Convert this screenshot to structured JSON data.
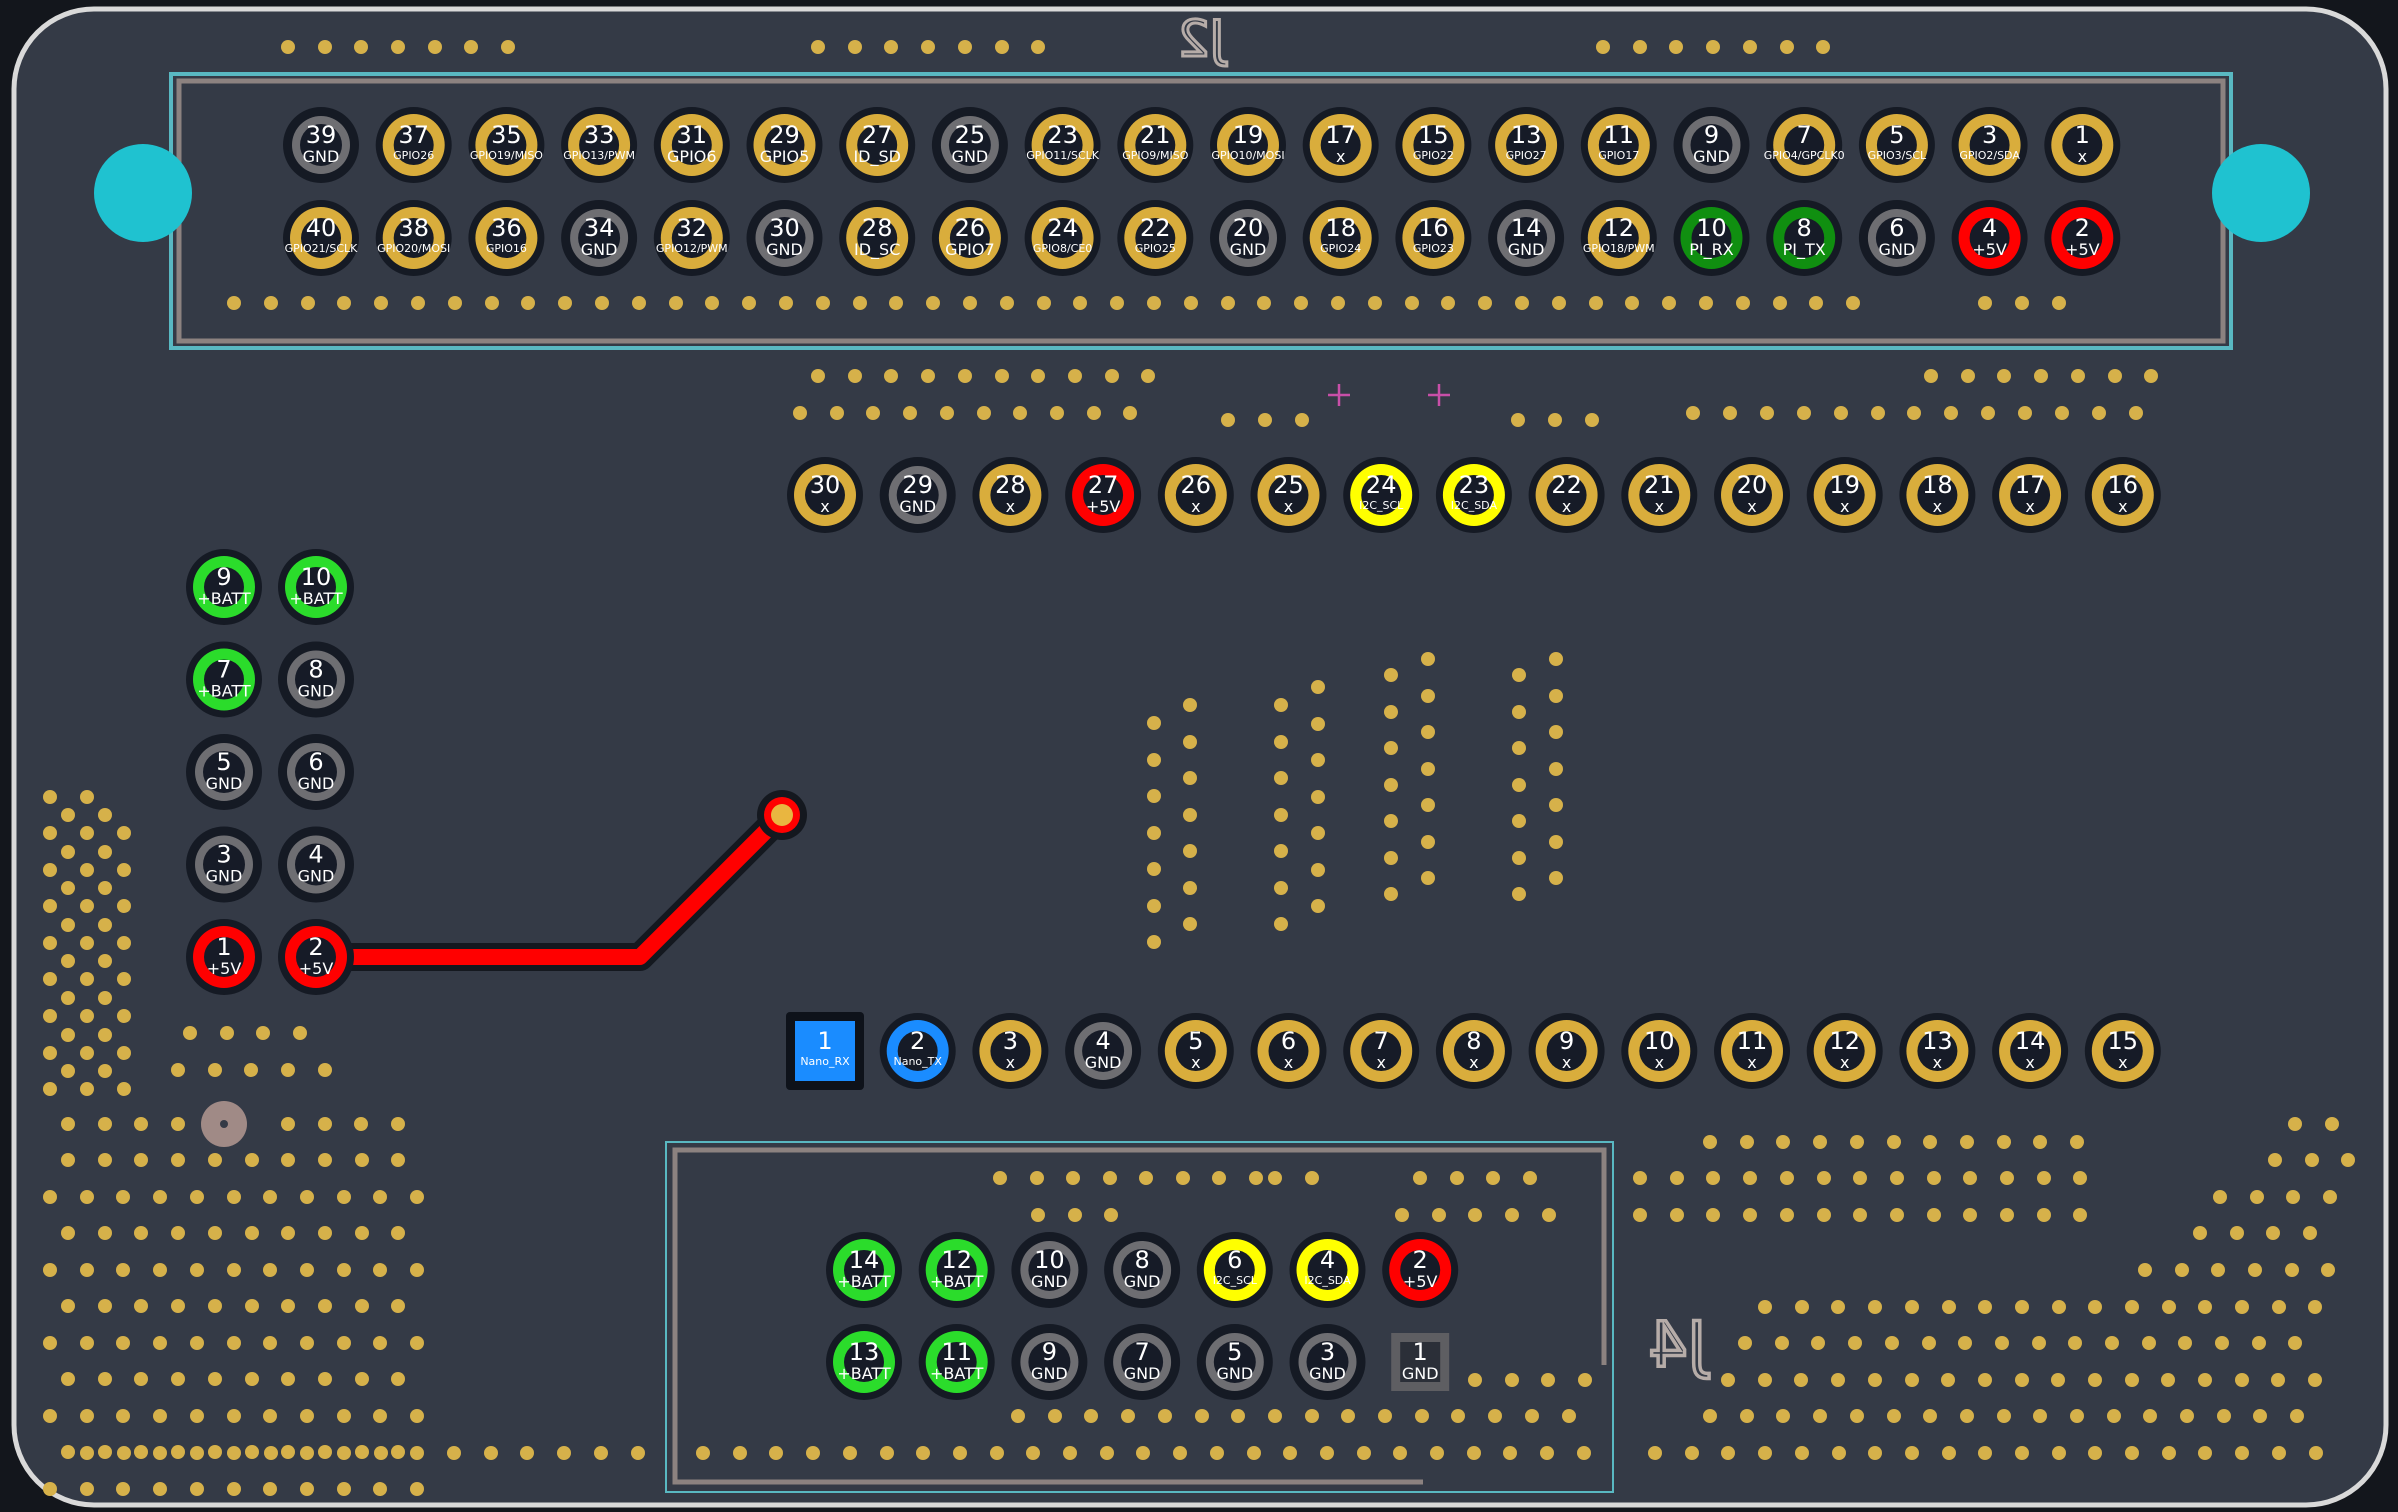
{
  "colors": {
    "background": "#13161c",
    "board": "#343a46",
    "edge": "#d9d9d9",
    "via": "#d6b14a",
    "pad_gold": "#d9ad3c",
    "pad_gray": "#6e6e72",
    "pad_red": "#ff0000",
    "pad_green": "#2bdc2b",
    "pad_darkgreen": "#108f10",
    "pad_yellow": "#ffff00",
    "pad_blue": "#1a8cff",
    "pad_hole": "#151a24",
    "trace": "#ff0000",
    "outline_teal": "#59b8c2",
    "outline_gray": "#8c8280",
    "mount_hole": "#1fc2d0",
    "silk": "#b6aca8",
    "cross": "#c84fa8"
  },
  "refs": {
    "j2": "J2",
    "j4": "J4"
  },
  "headers": {
    "j2_top": [
      {
        "n": "39",
        "net": "GND",
        "c": "gray"
      },
      {
        "n": "37",
        "net": "GPIO26",
        "c": "gold"
      },
      {
        "n": "35",
        "net": "GPIO19/MISO",
        "c": "gold"
      },
      {
        "n": "33",
        "net": "GPIO13/PWM",
        "c": "gold"
      },
      {
        "n": "31",
        "net": "GPIO6",
        "c": "gold"
      },
      {
        "n": "29",
        "net": "GPIO5",
        "c": "gold"
      },
      {
        "n": "27",
        "net": "ID_SD",
        "c": "gold"
      },
      {
        "n": "25",
        "net": "GND",
        "c": "gray"
      },
      {
        "n": "23",
        "net": "GPIO11/SCLK",
        "c": "gold"
      },
      {
        "n": "21",
        "net": "GPIO9/MISO",
        "c": "gold"
      },
      {
        "n": "19",
        "net": "GPIO10/MOSI",
        "c": "gold"
      },
      {
        "n": "17",
        "net": "x",
        "c": "gold"
      },
      {
        "n": "15",
        "net": "GPIO22",
        "c": "gold"
      },
      {
        "n": "13",
        "net": "GPIO27",
        "c": "gold"
      },
      {
        "n": "11",
        "net": "GPIO17",
        "c": "gold"
      },
      {
        "n": "9",
        "net": "GND",
        "c": "gray"
      },
      {
        "n": "7",
        "net": "GPIO4/GPCLK0",
        "c": "gold"
      },
      {
        "n": "5",
        "net": "GPIO3/SCL",
        "c": "gold"
      },
      {
        "n": "3",
        "net": "GPIO2/SDA",
        "c": "gold"
      },
      {
        "n": "1",
        "net": "x",
        "c": "gold"
      }
    ],
    "j2_bottom": [
      {
        "n": "40",
        "net": "GPIO21/SCLK",
        "c": "gold"
      },
      {
        "n": "38",
        "net": "GPIO20/MOSI",
        "c": "gold"
      },
      {
        "n": "36",
        "net": "GPIO16",
        "c": "gold"
      },
      {
        "n": "34",
        "net": "GND",
        "c": "gray"
      },
      {
        "n": "32",
        "net": "GPIO12/PWM",
        "c": "gold"
      },
      {
        "n": "30",
        "net": "GND",
        "c": "gray"
      },
      {
        "n": "28",
        "net": "ID_SC",
        "c": "gold"
      },
      {
        "n": "26",
        "net": "GPIO7",
        "c": "gold"
      },
      {
        "n": "24",
        "net": "GPIO8/CE0",
        "c": "gold"
      },
      {
        "n": "22",
        "net": "GPIO25",
        "c": "gold"
      },
      {
        "n": "20",
        "net": "GND",
        "c": "gray"
      },
      {
        "n": "18",
        "net": "GPIO24",
        "c": "gold"
      },
      {
        "n": "16",
        "net": "GPIO23",
        "c": "gold"
      },
      {
        "n": "14",
        "net": "GND",
        "c": "gray"
      },
      {
        "n": "12",
        "net": "GPIO18/PWM",
        "c": "gold"
      },
      {
        "n": "10",
        "net": "PI_RX",
        "c": "darkgreen"
      },
      {
        "n": "8",
        "net": "PI_TX",
        "c": "darkgreen"
      },
      {
        "n": "6",
        "net": "GND",
        "c": "gray"
      },
      {
        "n": "4",
        "net": "+5V",
        "c": "red"
      },
      {
        "n": "2",
        "net": "+5V",
        "c": "red"
      }
    ],
    "nano_top": [
      {
        "n": "30",
        "net": "x",
        "c": "gold"
      },
      {
        "n": "29",
        "net": "GND",
        "c": "gray"
      },
      {
        "n": "28",
        "net": "x",
        "c": "gold"
      },
      {
        "n": "27",
        "net": "+5V",
        "c": "red"
      },
      {
        "n": "26",
        "net": "x",
        "c": "gold"
      },
      {
        "n": "25",
        "net": "x",
        "c": "gold"
      },
      {
        "n": "24",
        "net": "I2C_SCL",
        "c": "yellow"
      },
      {
        "n": "23",
        "net": "I2C_SDA",
        "c": "yellow"
      },
      {
        "n": "22",
        "net": "x",
        "c": "gold"
      },
      {
        "n": "21",
        "net": "x",
        "c": "gold"
      },
      {
        "n": "20",
        "net": "x",
        "c": "gold"
      },
      {
        "n": "19",
        "net": "x",
        "c": "gold"
      },
      {
        "n": "18",
        "net": "x",
        "c": "gold"
      },
      {
        "n": "17",
        "net": "x",
        "c": "gold"
      },
      {
        "n": "16",
        "net": "x",
        "c": "gold"
      }
    ],
    "nano_bottom": [
      {
        "n": "1",
        "net": "Nano_RX",
        "c": "blue",
        "square": true
      },
      {
        "n": "2",
        "net": "Nano_TX",
        "c": "blue"
      },
      {
        "n": "3",
        "net": "x",
        "c": "gold"
      },
      {
        "n": "4",
        "net": "GND",
        "c": "gray"
      },
      {
        "n": "5",
        "net": "x",
        "c": "gold"
      },
      {
        "n": "6",
        "net": "x",
        "c": "gold"
      },
      {
        "n": "7",
        "net": "x",
        "c": "gold"
      },
      {
        "n": "8",
        "net": "x",
        "c": "gold"
      },
      {
        "n": "9",
        "net": "x",
        "c": "gold"
      },
      {
        "n": "10",
        "net": "x",
        "c": "gold"
      },
      {
        "n": "11",
        "net": "x",
        "c": "gold"
      },
      {
        "n": "12",
        "net": "x",
        "c": "gold"
      },
      {
        "n": "13",
        "net": "x",
        "c": "gold"
      },
      {
        "n": "14",
        "net": "x",
        "c": "gold"
      },
      {
        "n": "15",
        "net": "x",
        "c": "gold"
      }
    ],
    "power_left": [
      {
        "n": "9",
        "net": "+BATT",
        "c": "green"
      },
      {
        "n": "7",
        "net": "+BATT",
        "c": "green"
      },
      {
        "n": "5",
        "net": "GND",
        "c": "gray"
      },
      {
        "n": "3",
        "net": "GND",
        "c": "gray"
      },
      {
        "n": "1",
        "net": "+5V",
        "c": "red"
      }
    ],
    "power_right": [
      {
        "n": "10",
        "net": "+BATT",
        "c": "green"
      },
      {
        "n": "8",
        "net": "GND",
        "c": "gray"
      },
      {
        "n": "6",
        "net": "GND",
        "c": "gray"
      },
      {
        "n": "4",
        "net": "GND",
        "c": "gray"
      },
      {
        "n": "2",
        "net": "+5V",
        "c": "red"
      }
    ],
    "j4_top": [
      {
        "n": "14",
        "net": "+BATT",
        "c": "green"
      },
      {
        "n": "12",
        "net": "+BATT",
        "c": "green"
      },
      {
        "n": "10",
        "net": "GND",
        "c": "gray"
      },
      {
        "n": "8",
        "net": "GND",
        "c": "gray"
      },
      {
        "n": "6",
        "net": "I2C_SCL",
        "c": "yellow"
      },
      {
        "n": "4",
        "net": "I2C_SDA",
        "c": "yellow"
      },
      {
        "n": "2",
        "net": "+5V",
        "c": "red"
      }
    ],
    "j4_bottom": [
      {
        "n": "13",
        "net": "+BATT",
        "c": "green"
      },
      {
        "n": "11",
        "net": "+BATT",
        "c": "green"
      },
      {
        "n": "9",
        "net": "GND",
        "c": "gray"
      },
      {
        "n": "7",
        "net": "GND",
        "c": "gray"
      },
      {
        "n": "5",
        "net": "GND",
        "c": "gray"
      },
      {
        "n": "3",
        "net": "GND",
        "c": "gray"
      },
      {
        "n": "1",
        "net": "GND",
        "c": "gray",
        "square": true
      }
    ]
  }
}
